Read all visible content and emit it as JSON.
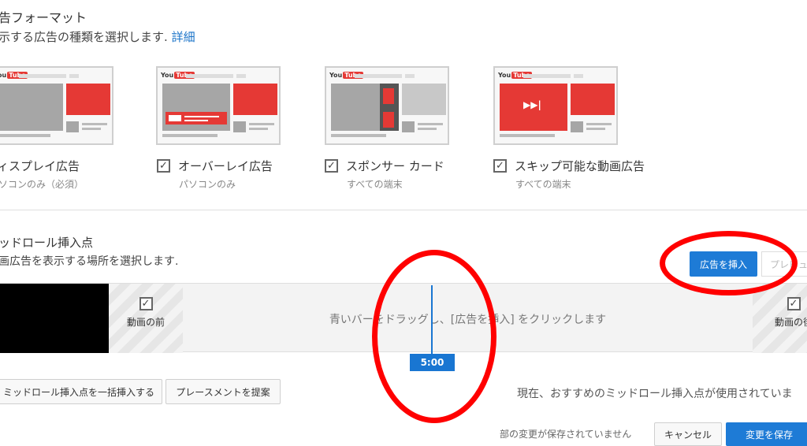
{
  "ad_format": {
    "title": "告フォーマット",
    "subtitle": "示する広告の種類を選択します.",
    "detail_link": "詳細",
    "cards": [
      {
        "label": "ィスプレイ広告",
        "caption": "ソコンのみ（必須）",
        "checked": false
      },
      {
        "label": "オーバーレイ広告",
        "caption": "パソコンのみ",
        "checked": true
      },
      {
        "label": "スポンサー カード",
        "caption": "すべての端末",
        "checked": true
      },
      {
        "label": "スキップ可能な動画広告",
        "caption": "すべての端末",
        "checked": true
      }
    ],
    "logo_you": "You",
    "logo_tube": "Tube",
    "skip_glyph": "▶▶|"
  },
  "midroll": {
    "title": "ッドロール挿入点",
    "subtitle": "画広告を表示する場所を選択します.",
    "insert_button": "広告を挿入",
    "preview_button": "プレビュ",
    "before_label": "動画の前",
    "after_label": "動画の後",
    "check_glyph": "✓",
    "hint": "青いバーをドラッグし、[広告を挿入] をクリックします",
    "slider_time": "5:00",
    "bulk_insert_button": "ミッドロール挿入点を一括挿入する",
    "suggest_button": "プレースメントを提案",
    "status_text": "現在、おすすめのミッドロール挿入点が使用されていま"
  },
  "footer": {
    "unsaved_text": "部の変更が保存されていません",
    "cancel_button": "キャンセル",
    "save_button": "変更を保存"
  },
  "colors": {
    "accent_blue": "#1e7bd6",
    "annotation_red": "#ff0000",
    "thumb_red": "#e53935"
  }
}
